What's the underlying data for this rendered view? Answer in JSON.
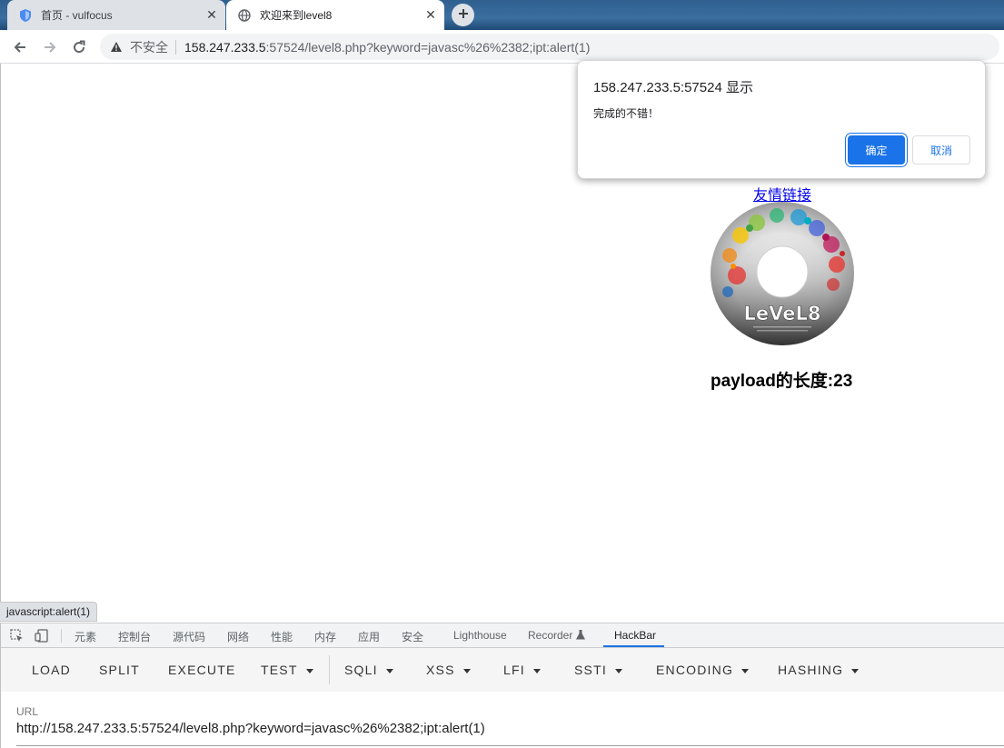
{
  "browser": {
    "tabs": [
      {
        "title": "首页 - vulfocus",
        "favicon": "shield-icon",
        "active": false
      },
      {
        "title": "欢迎来到level8",
        "favicon": "globe-icon",
        "active": true
      }
    ],
    "omnibox": {
      "security_label": "不安全",
      "url_host": "158.247.233.5",
      "url_rest": ":57524/level8.php?keyword=javasc%26%2382;ipt:alert(1)"
    }
  },
  "page": {
    "friend_link": "友情链接",
    "image_text": "LeVeL8",
    "payload_length": "payload的长度:23"
  },
  "dialog": {
    "title": "158.247.233.5:57524 显示",
    "message": "完成的不错！",
    "ok_label": "确定",
    "cancel_label": "取消",
    "ok_color": "#1a73e8"
  },
  "status_bar": {
    "text": "javascript:alert(1)"
  },
  "devtools": {
    "tabs": [
      "元素",
      "控制台",
      "源代码",
      "网络",
      "性能",
      "内存",
      "应用",
      "安全",
      "Lighthouse",
      "Recorder",
      "HackBar"
    ],
    "active_tab": "HackBar",
    "accent": "#1a73e8"
  },
  "hackbar": {
    "buttons": [
      "LOAD",
      "SPLIT",
      "EXECUTE"
    ],
    "dropdowns": [
      "TEST",
      "SQLI",
      "XSS",
      "LFI",
      "SSTI",
      "ENCODING",
      "HASHING"
    ],
    "url_label": "URL",
    "url_value": "http://158.247.233.5:57524/level8.php?keyword=javasc%26%2382;ipt:alert(1)"
  }
}
